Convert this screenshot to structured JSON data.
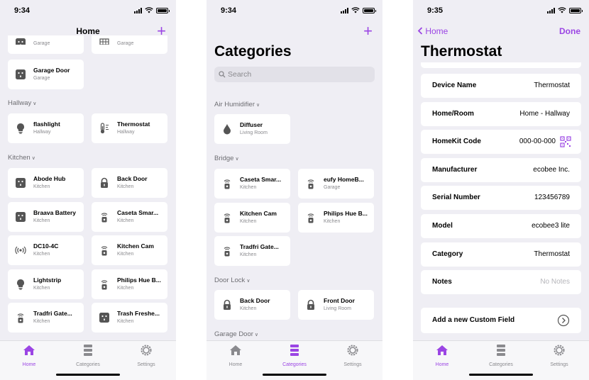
{
  "status": {
    "time1": "9:34",
    "time2": "9:34",
    "time3": "9:35"
  },
  "screen1": {
    "title": "Home",
    "top_partial": [
      {
        "room": "Garage"
      },
      {
        "room": "Garage"
      }
    ],
    "top_cards": [
      {
        "name": "Garage Door",
        "room": "Garage",
        "icon": "outlet-icon"
      }
    ],
    "sections": [
      {
        "header": "Hallway",
        "cards": [
          {
            "name": "flashlight",
            "room": "Hallway",
            "icon": "lightbulb-icon"
          },
          {
            "name": "Thermostat",
            "room": "Hallway",
            "icon": "thermometer-icon"
          }
        ]
      },
      {
        "header": "Kitchen",
        "cards": [
          {
            "name": "Abode Hub",
            "room": "Kitchen",
            "icon": "outlet-icon"
          },
          {
            "name": "Back Door",
            "room": "Kitchen",
            "icon": "lock-icon"
          },
          {
            "name": "Braava Battery",
            "room": "Kitchen",
            "icon": "outlet-icon"
          },
          {
            "name": "Caseta Smar...",
            "room": "Kitchen",
            "icon": "bridge-icon"
          },
          {
            "name": "DC10-4C",
            "room": "Kitchen",
            "icon": "radio-waves-icon"
          },
          {
            "name": "Kitchen Cam",
            "room": "Kitchen",
            "icon": "bridge-icon"
          },
          {
            "name": "Lightstrip",
            "room": "Kitchen",
            "icon": "lightbulb-icon"
          },
          {
            "name": "Philips Hue B...",
            "room": "Kitchen",
            "icon": "bridge-icon"
          },
          {
            "name": "Tradfri Gate...",
            "room": "Kitchen",
            "icon": "bridge-icon"
          },
          {
            "name": "Trash Freshe...",
            "room": "Kitchen",
            "icon": "outlet-icon"
          }
        ]
      }
    ]
  },
  "screen2": {
    "title": "Categories",
    "search_placeholder": "Search",
    "sections": [
      {
        "header": "Air Humidifier",
        "cards": [
          {
            "name": "Diffuser",
            "room": "Living Room",
            "icon": "drop-icon"
          }
        ]
      },
      {
        "header": "Bridge",
        "cards": [
          {
            "name": "Caseta Smar...",
            "room": "Kitchen",
            "icon": "bridge-icon"
          },
          {
            "name": "eufy HomeB...",
            "room": "Garage",
            "icon": "bridge-icon"
          },
          {
            "name": "Kitchen Cam",
            "room": "Kitchen",
            "icon": "bridge-icon"
          },
          {
            "name": "Philips Hue B...",
            "room": "Kitchen",
            "icon": "bridge-icon"
          },
          {
            "name": "Tradfri Gate...",
            "room": "Kitchen",
            "icon": "bridge-icon"
          }
        ]
      },
      {
        "header": "Door Lock",
        "cards": [
          {
            "name": "Back Door",
            "room": "Kitchen",
            "icon": "lock-icon"
          },
          {
            "name": "Front Door",
            "room": "Living Room",
            "icon": "lock-icon"
          }
        ]
      },
      {
        "header": "Garage Door",
        "cards": []
      }
    ]
  },
  "screen3": {
    "back_label": "Home",
    "done_label": "Done",
    "title": "Thermostat",
    "fields": [
      {
        "key": "Device Name",
        "value": "Thermostat"
      },
      {
        "key": "Home/Room",
        "value": "Home - Hallway"
      },
      {
        "key": "HomeKit Code",
        "value": "000-00-000"
      },
      {
        "key": "Manufacturer",
        "value": "ecobee Inc."
      },
      {
        "key": "Serial Number",
        "value": "123456789"
      },
      {
        "key": "Model",
        "value": "ecobee3 lite"
      },
      {
        "key": "Category",
        "value": "Thermostat"
      },
      {
        "key": "Notes",
        "value": "No Notes"
      }
    ],
    "custom_field_label": "Add a new Custom Field"
  },
  "tabs": [
    {
      "label": "Home",
      "icon": "house-icon"
    },
    {
      "label": "Categories",
      "icon": "server-stack-icon"
    },
    {
      "label": "Settings",
      "icon": "gear-icon"
    }
  ],
  "colors": {
    "accent": "#9b45e4",
    "background": "#efeef4",
    "card": "#ffffff",
    "secondary_text": "#8a8a8e"
  }
}
